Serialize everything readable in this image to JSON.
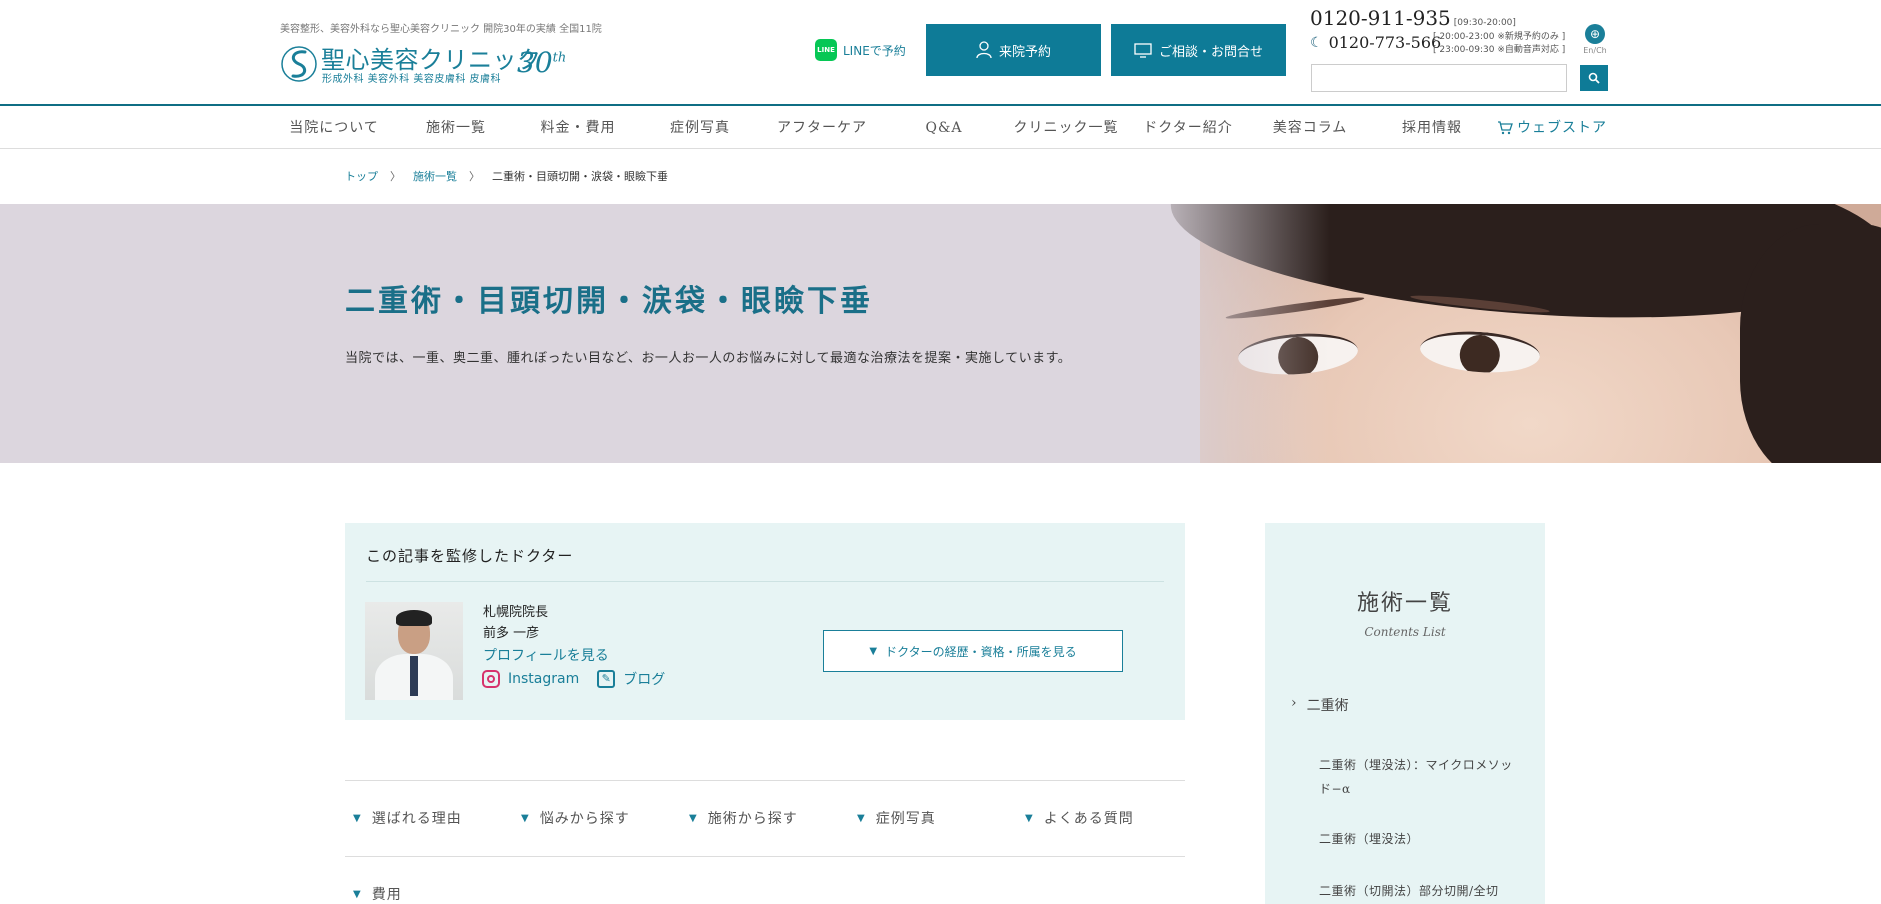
{
  "header": {
    "tagline": "美容整形、美容外科なら聖心美容クリニック 開院30年の実績 全国11院",
    "logo_name": "聖心美容クリニック",
    "logo_anniv": "30",
    "logo_anniv_suffix": "th",
    "logo_sub": "形成外科 美容外科 美容皮膚科 皮膚科",
    "line_icon": "LINE",
    "line_label": "LINEで予約",
    "reserve_label": "来院予約",
    "consult_label": "ご相談・お問合せ",
    "phone1": "0120-911-935",
    "phone1_hours": "[09:30-20:00]",
    "phone2": "0120-773-566",
    "phone2_note1": "[ 20:00-23:00 ※新規予約のみ ]",
    "phone2_note2": "[ 23:00-09:30 ※自動音声対応 ]",
    "lang_label": "En/Ch",
    "search_placeholder": ""
  },
  "nav": {
    "items": [
      "当院について",
      "施術一覧",
      "料金・費用",
      "症例写真",
      "アフターケア",
      "Q&A",
      "クリニック一覧",
      "ドクター紹介",
      "美容コラム",
      "採用情報"
    ],
    "store_label": "ウェブストア"
  },
  "breadcrumb": {
    "top": "トップ",
    "list": "施術一覧",
    "current": "二重術・目頭切開・涙袋・眼瞼下垂",
    "sep": "〉"
  },
  "hero": {
    "title": "二重術・目頭切開・涙袋・眼瞼下垂",
    "description": "当院では、一重、奥二重、腫れぼったい目など、お一人お一人のお悩みに対して最適な治療法を提案・実施しています。"
  },
  "doctor": {
    "heading": "この記事を監修したドクター",
    "title": "札幌院院長",
    "name": "前多 一彦",
    "profile_link": "プロフィールを見る",
    "instagram": "Instagram",
    "blog": "ブログ",
    "career_button": "ドクターの経歴・資格・所属を見る"
  },
  "anchors": {
    "row1": [
      "選ばれる理由",
      "悩みから探す",
      "施術から探す",
      "症例写真",
      "よくある質問"
    ],
    "row2": [
      "費用"
    ]
  },
  "sidebar": {
    "title": "施術一覧",
    "subtitle": "Contents List",
    "category": "二重術",
    "links": [
      "二重術（埋没法）：マイクロメソッド−α",
      "二重術（埋没法）",
      "二重術（切開法）部分切開/全切"
    ]
  },
  "colors": {
    "accent": "#0e7b97",
    "link": "#1a7f99",
    "hero_bg": "#dcd6de",
    "card_bg": "#e7f4f4"
  }
}
